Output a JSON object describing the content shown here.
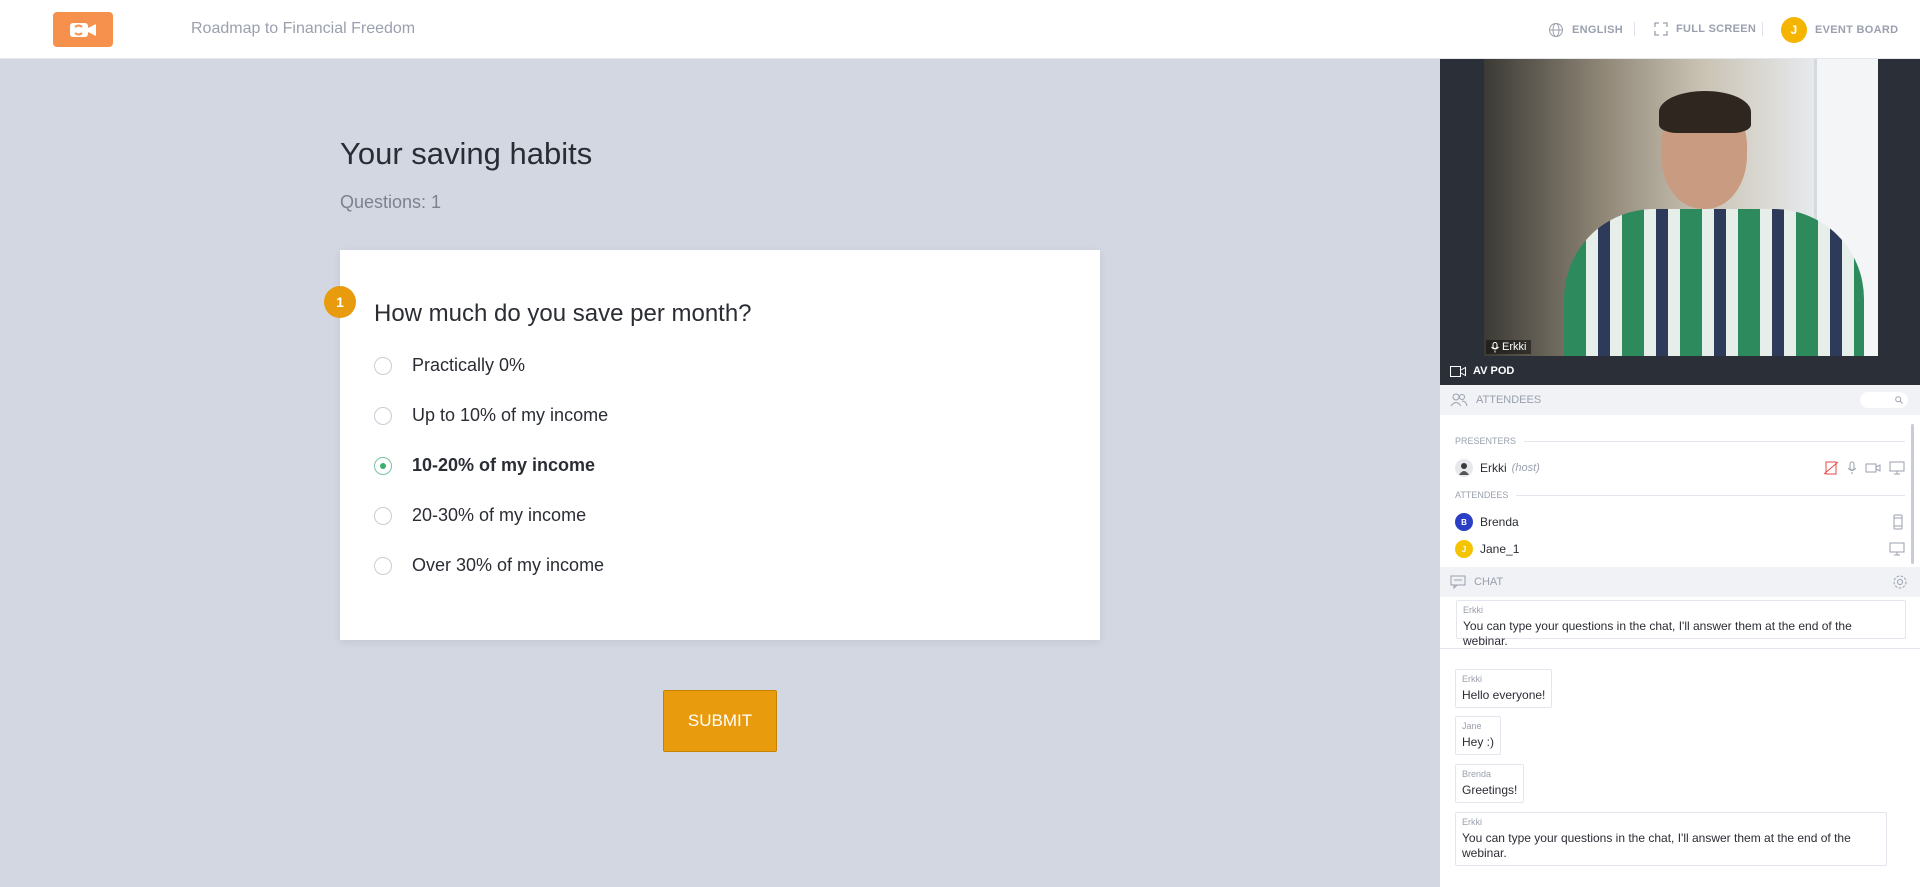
{
  "header": {
    "title": "Roadmap to Financial Freedom",
    "language": "ENGLISH",
    "fullscreen": "FULL SCREEN",
    "user_initial": "J",
    "event_board": "EVENT BOARD"
  },
  "quiz": {
    "title": "Your saving habits",
    "questions_count": "Questions: 1",
    "question_number": "1",
    "question": "How much do you save per month?",
    "options": [
      {
        "label": "Practically 0%",
        "selected": false
      },
      {
        "label": "Up to 10% of my income",
        "selected": false
      },
      {
        "label": "10-20% of my income",
        "selected": true
      },
      {
        "label": "20-30% of my income",
        "selected": false
      },
      {
        "label": "Over 30% of my income",
        "selected": false
      }
    ],
    "submit": "SUBMIT"
  },
  "video": {
    "speaker": "Erkki",
    "pod_label": "AV POD"
  },
  "attendees_panel": {
    "header": "ATTENDEES",
    "presenters_label": "PRESENTERS",
    "attendees_label": "ATTENDEES",
    "presenters": [
      {
        "name": "Erkki",
        "role": "(host)"
      }
    ],
    "attendees": [
      {
        "name": "Brenda",
        "initial": "B",
        "color": "#2b3fc4"
      },
      {
        "name": "Jane_1",
        "initial": "J",
        "color": "#f5c400"
      }
    ]
  },
  "chat": {
    "header": "CHAT",
    "pinned": {
      "author": "Erkki",
      "text": "You can type your questions in the chat, I'll answer them at the end of the webinar."
    },
    "messages": [
      {
        "author": "Erkki",
        "text": "Hello everyone!"
      },
      {
        "author": "Jane",
        "text": "Hey :)"
      },
      {
        "author": "Brenda",
        "text": "Greetings!"
      },
      {
        "author": "Erkki",
        "text": "You can type your questions in the chat, I'll answer them at the end of the webinar."
      }
    ]
  },
  "colors": {
    "accent": "#e89b0c",
    "logo": "#f5914c",
    "background": "#d3d7e1"
  }
}
